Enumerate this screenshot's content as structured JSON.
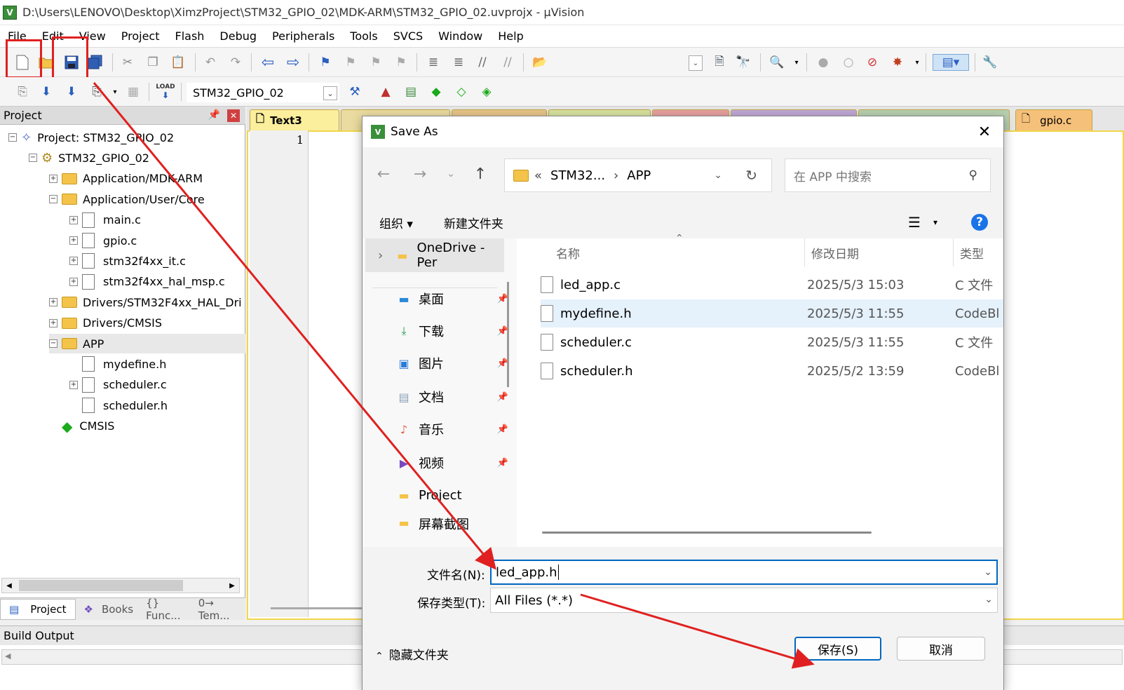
{
  "window": {
    "title": "D:\\Users\\LENOVO\\Desktop\\XimzProject\\STM32_GPIO_02\\MDK-ARM\\STM32_GPIO_02.uvprojx - µVision",
    "app_icon": "V"
  },
  "menu": [
    "File",
    "Edit",
    "View",
    "Project",
    "Flash",
    "Debug",
    "Peripherals",
    "Tools",
    "SVCS",
    "Window",
    "Help"
  ],
  "toolbar": {
    "target_name": "STM32_GPIO_02",
    "load_label": "LOAD"
  },
  "project_panel": {
    "title": "Project",
    "tree": [
      {
        "label": "Project: STM32_GPIO_02",
        "indent": 0,
        "toggle": "−",
        "icon": "project"
      },
      {
        "label": "STM32_GPIO_02",
        "indent": 1,
        "toggle": "−",
        "icon": "target"
      },
      {
        "label": "Application/MDK-ARM",
        "indent": 2,
        "toggle": "+",
        "icon": "folder"
      },
      {
        "label": "Application/User/Core",
        "indent": 2,
        "toggle": "−",
        "icon": "folder-open"
      },
      {
        "label": "main.c",
        "indent": 3,
        "toggle": "+",
        "icon": "file"
      },
      {
        "label": "gpio.c",
        "indent": 3,
        "toggle": "+",
        "icon": "file"
      },
      {
        "label": "stm32f4xx_it.c",
        "indent": 3,
        "toggle": "+",
        "icon": "file"
      },
      {
        "label": "stm32f4xx_hal_msp.c",
        "indent": 3,
        "toggle": "+",
        "icon": "file"
      },
      {
        "label": "Drivers/STM32F4xx_HAL_Dri",
        "indent": 2,
        "toggle": "+",
        "icon": "folder"
      },
      {
        "label": "Drivers/CMSIS",
        "indent": 2,
        "toggle": "+",
        "icon": "folder"
      },
      {
        "label": "APP",
        "indent": 2,
        "toggle": "−",
        "icon": "folder-open"
      },
      {
        "label": "mydefine.h",
        "indent": 3,
        "toggle": "",
        "icon": "file"
      },
      {
        "label": "scheduler.c",
        "indent": 3,
        "toggle": "+",
        "icon": "file"
      },
      {
        "label": "scheduler.h",
        "indent": 3,
        "toggle": "",
        "icon": "file"
      },
      {
        "label": "CMSIS",
        "indent": 2,
        "toggle": "",
        "icon": "cmsis"
      }
    ],
    "tabs": [
      "Project",
      "Books",
      "{} Func...",
      "0→ Tem..."
    ]
  },
  "editor": {
    "tabs": [
      "Text3",
      "gpio.c"
    ],
    "line_number": "1"
  },
  "build_output": {
    "title": "Build Output"
  },
  "dialog": {
    "title": "Save As",
    "breadcrumb": [
      "«",
      "STM32...",
      "›",
      "APP"
    ],
    "search_placeholder": "在 APP 中搜索",
    "organize": "组织 ▾",
    "new_folder": "新建文件夹",
    "nav": [
      {
        "label": "OneDrive - Per",
        "icon": "folder"
      },
      {
        "label": "桌面",
        "icon": "desktop"
      },
      {
        "label": "下载",
        "icon": "download"
      },
      {
        "label": "图片",
        "icon": "pictures"
      },
      {
        "label": "文档",
        "icon": "documents"
      },
      {
        "label": "音乐",
        "icon": "music"
      },
      {
        "label": "视频",
        "icon": "videos"
      },
      {
        "label": "Project",
        "icon": "folder"
      },
      {
        "label": "屏幕截图",
        "icon": "folder"
      }
    ],
    "columns": {
      "name": "名称",
      "date": "修改日期",
      "type": "类型"
    },
    "files": [
      {
        "name": "led_app.c",
        "date": "2025/5/3 15:03",
        "type": "C 文件"
      },
      {
        "name": "mydefine.h",
        "date": "2025/5/3 11:55",
        "type": "CodeBl"
      },
      {
        "name": "scheduler.c",
        "date": "2025/5/3 11:55",
        "type": "C 文件"
      },
      {
        "name": "scheduler.h",
        "date": "2025/5/2 13:59",
        "type": "CodeBl"
      }
    ],
    "filename_label": "文件名(N):",
    "filename_value": "led_app.h",
    "filetype_label": "保存类型(T):",
    "filetype_value": "All Files (*.*)",
    "hide_folders": "隐藏文件夹",
    "save_button": "保存(S)",
    "cancel_button": "取消"
  },
  "colors": {
    "annotation_red": "#e02020",
    "editor_tab": "#f7e59a",
    "accent_blue": "#0067c0"
  }
}
